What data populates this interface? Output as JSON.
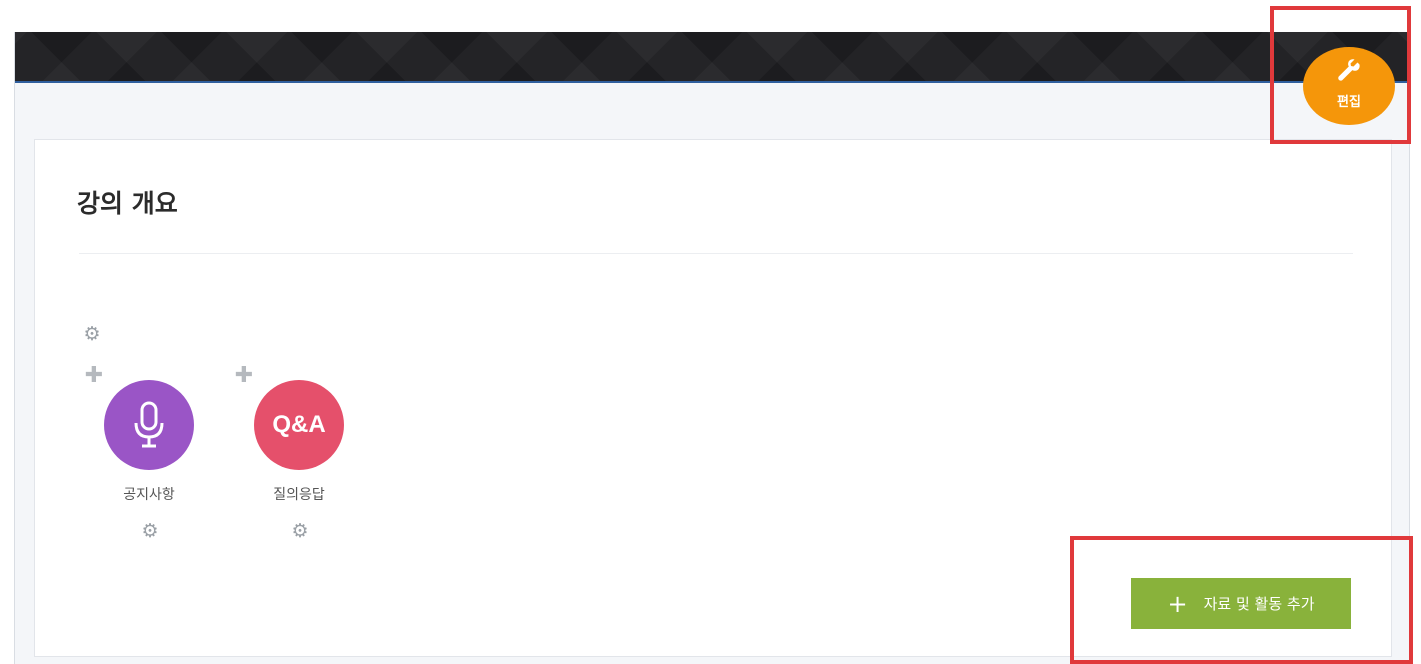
{
  "section": {
    "title": "강의 개요"
  },
  "activities": [
    {
      "label": "공지사항",
      "icon": "microphone-icon",
      "color": "#9a55c6"
    },
    {
      "label": "질의응답",
      "icon": "qa-icon",
      "icon_text": "Q&A",
      "color": "#e5506b"
    }
  ],
  "edit_button": {
    "label": "편집",
    "icon": "wrench-icon",
    "color": "#f5960a"
  },
  "add_button": {
    "label": "자료 및 활동 추가",
    "icon": "plus-icon",
    "color": "#89b23b"
  },
  "highlight_color": "#e0393b"
}
